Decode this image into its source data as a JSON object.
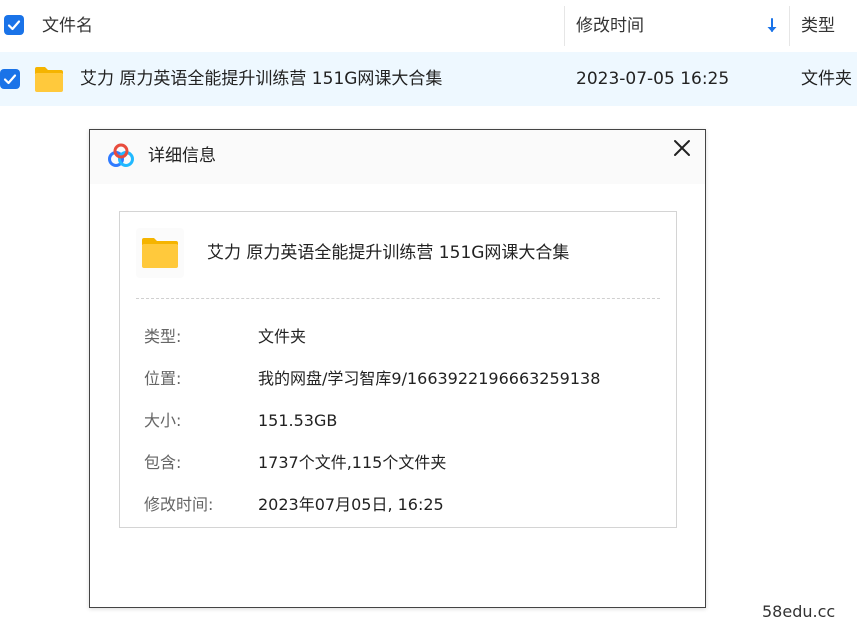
{
  "list_header": {
    "col_name": "文件名",
    "col_modified": "修改时间",
    "col_type": "类型",
    "sort_icon": "arrow-down-icon"
  },
  "file_row": {
    "name": "艾力 原力英语全能提升训练营 151G网课大合集",
    "modified": "2023-07-05 16:25",
    "type": "文件夹",
    "selected": true
  },
  "dialog": {
    "title": "详细信息",
    "logo_icon": "baidu-netdisk-logo-icon",
    "close_icon": "close-icon",
    "file_name": "艾力 原力英语全能提升训练营 151G网课大合集",
    "properties": [
      {
        "label": "类型:",
        "value": "文件夹"
      },
      {
        "label": "位置:",
        "value": "我的网盘/学习智库9/1663922196663259138"
      },
      {
        "label": "大小:",
        "value": "151.53GB"
      },
      {
        "label": "包含:",
        "value": "1737个文件,115个文件夹"
      },
      {
        "label": "修改时间:",
        "value": "2023年07月05日, 16:25"
      }
    ]
  },
  "watermark": "58edu.cc",
  "colors": {
    "accent": "#1a73e8",
    "selected_row": "#eef8ff",
    "folder_yellow": "#ffc93c"
  }
}
